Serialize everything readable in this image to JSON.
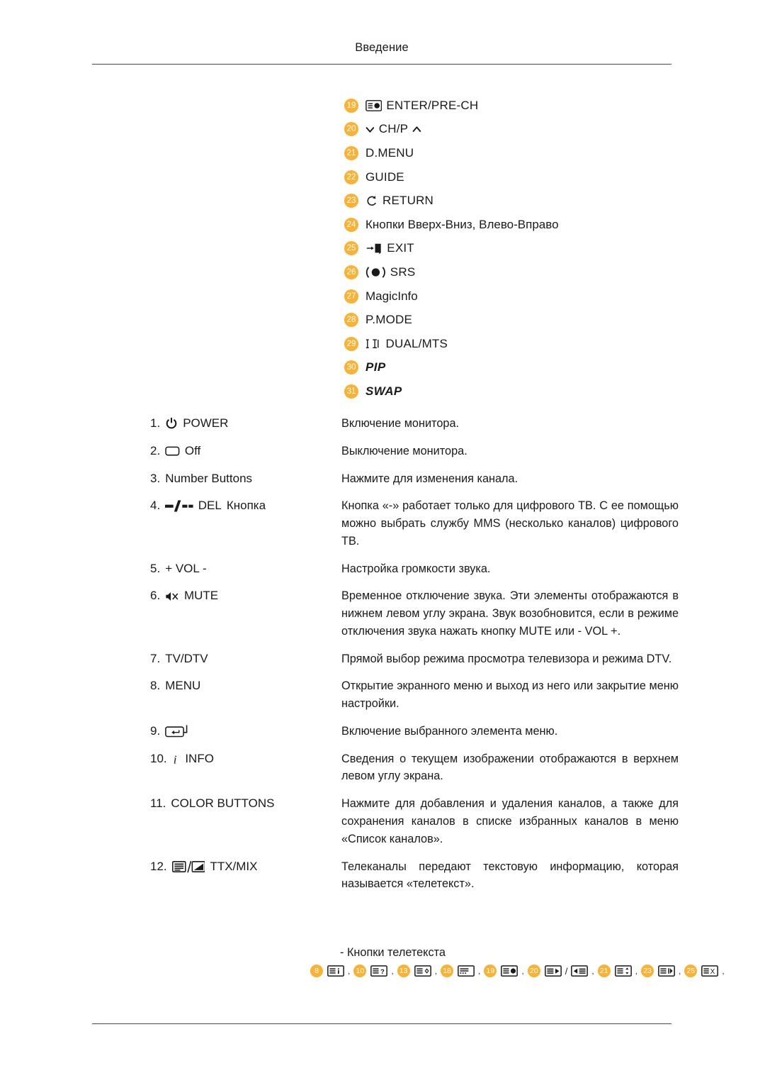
{
  "header": {
    "title": "Введение"
  },
  "legend": {
    "items": [
      {
        "num": "19",
        "icon": "enter-prech-icon",
        "label": "ENTER/PRE-CH",
        "style": "caps"
      },
      {
        "num": "20",
        "icon": "chevron-down-up-icon",
        "label": "CH/P",
        "style": "caps"
      },
      {
        "num": "21",
        "icon": "",
        "label": "D.MENU",
        "style": "caps"
      },
      {
        "num": "22",
        "icon": "",
        "label": "GUIDE",
        "style": "caps"
      },
      {
        "num": "23",
        "icon": "return-arrow-icon",
        "label": "RETURN",
        "style": "caps"
      },
      {
        "num": "24",
        "icon": "",
        "label": "Кнопки Вверх-Вниз, Влево-Вправо",
        "style": "normal"
      },
      {
        "num": "25",
        "icon": "exit-door-icon",
        "label": "EXIT",
        "style": "caps"
      },
      {
        "num": "26",
        "icon": "srs-icon",
        "label": "SRS",
        "style": "caps"
      },
      {
        "num": "27",
        "icon": "",
        "label": "MagicInfo",
        "style": "normal"
      },
      {
        "num": "28",
        "icon": "",
        "label": "P.MODE",
        "style": "caps"
      },
      {
        "num": "29",
        "icon": "dual-mts-icon",
        "label": "DUAL/MTS",
        "style": "caps"
      },
      {
        "num": "30",
        "icon": "",
        "label": "PIP",
        "style": "italic"
      },
      {
        "num": "31",
        "icon": "",
        "label": "SWAP",
        "style": "italic"
      }
    ]
  },
  "descriptions": {
    "rows": [
      {
        "num": "1.",
        "icon": "power-icon",
        "label": "POWER",
        "text": "Включение монитора."
      },
      {
        "num": "2.",
        "icon": "off-rect-icon",
        "label": "Off",
        "text": "Выключение монитора."
      },
      {
        "num": "3.",
        "icon": "",
        "label": "Number Buttons",
        "text": "Нажмите для изменения канала."
      },
      {
        "num": "4.",
        "icon": "del-dash-icon",
        "label": "DEL",
        "label_after": "Кнопка",
        "text": "Кнопка «-» работает только для цифрового ТВ. С ее помощью можно выбрать службу MMS (несколько каналов) цифрового ТВ."
      },
      {
        "num": "5.",
        "icon": "",
        "label": "+ VOL -",
        "text": "Настройка громкости звука."
      },
      {
        "num": "6.",
        "icon": "mute-icon",
        "label": "MUTE",
        "text": "Временное отключение звука. Эти элементы отображаются в нижнем левом углу экрана. Звук возобновится, если в режиме отключения звука нажать кнопку MUTE или - VOL +."
      },
      {
        "num": "7.",
        "icon": "",
        "label": "TV/DTV",
        "text": "Прямой выбор режима просмотра телевизора и режима DTV."
      },
      {
        "num": "8.",
        "icon": "",
        "label": "MENU",
        "text": "Открытие экранного меню и выход из него или закрытие меню настройки."
      },
      {
        "num": "9.",
        "icon": "enter-key-icon",
        "label": "",
        "text": "Включение выбранного элемента меню."
      },
      {
        "num": "10.",
        "icon": "info-i-icon",
        "label": "INFO",
        "text": "Сведения о текущем изображении отображаются в верхнем левом углу экрана."
      },
      {
        "num": "11.",
        "icon": "",
        "label": "COLOR BUTTONS",
        "text": "Нажмите для добавления и удаления каналов, а также для сохранения каналов в списке избранных каналов в меню «Список каналов»."
      },
      {
        "num": "12.",
        "icon": "ttx-mix-icon",
        "label": "TTX/MIX",
        "text": "Телеканалы передают текстовую информацию, которая называется «телетекст»."
      }
    ]
  },
  "teletext": {
    "note": "- Кнопки телетекста",
    "buttons": [
      {
        "num": "8",
        "icon": "ttx-index-icon",
        "sep": ","
      },
      {
        "num": "10",
        "icon": "ttx-reveal-icon",
        "sep": ","
      },
      {
        "num": "13",
        "icon": "ttx-size-icon",
        "sep": ","
      },
      {
        "num": "18",
        "icon": "ttx-store-icon",
        "sep": ","
      },
      {
        "num": "19",
        "icon": "ttx-mode-icon",
        "sep": ","
      },
      {
        "num": "20",
        "icon": "ttx-page-next-icon",
        "icon2": "ttx-page-prev-icon",
        "slash": "/",
        "sep": ","
      },
      {
        "num": "21",
        "icon": "ttx-subpage-icon",
        "sep": ","
      },
      {
        "num": "23",
        "icon": "ttx-hold-icon",
        "sep": ","
      },
      {
        "num": "25",
        "icon": "ttx-cancel-icon",
        "sep": ","
      }
    ]
  },
  "colors": {
    "badge": "#f9b233",
    "rule": "#4a4a4a",
    "text": "#1a1a1a"
  }
}
